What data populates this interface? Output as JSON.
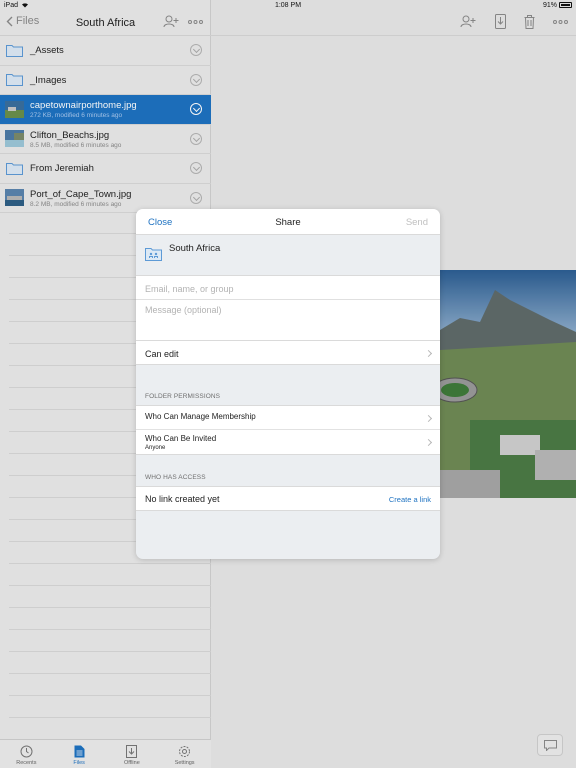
{
  "status_bar": {
    "device": "iPad",
    "time": "1:08 PM",
    "battery": "91%"
  },
  "left_nav": {
    "back_label": "Files",
    "title": "South Africa"
  },
  "files": [
    {
      "name": "_Assets",
      "kind": "folder",
      "meta": "",
      "selected": false
    },
    {
      "name": "_Images",
      "kind": "folder",
      "meta": "",
      "selected": false
    },
    {
      "name": "capetownairporthome.jpg",
      "kind": "image",
      "meta": "272 KB, modified 6 minutes ago",
      "selected": true
    },
    {
      "name": "Clifton_Beachs.jpg",
      "kind": "image",
      "meta": "8.5 MB, modified 6 minutes ago",
      "selected": false
    },
    {
      "name": "From Jeremiah",
      "kind": "folder",
      "meta": "",
      "selected": false
    },
    {
      "name": "Port_of_Cape_Town.jpg",
      "kind": "image",
      "meta": "8.2 MB, modified 6 minutes ago",
      "selected": false
    }
  ],
  "tabs": [
    {
      "label": "Recents",
      "icon": "clock-icon",
      "active": false
    },
    {
      "label": "Files",
      "icon": "file-icon",
      "active": true
    },
    {
      "label": "Offline",
      "icon": "offline-icon",
      "active": false
    },
    {
      "label": "Settings",
      "icon": "gear-icon",
      "active": false
    }
  ],
  "share": {
    "close_label": "Close",
    "title": "Share",
    "send_label": "Send",
    "folder_name": "South Africa",
    "email_placeholder": "Email, name, or group",
    "message_placeholder": "Message (optional)",
    "permission_label": "Can edit",
    "folder_permissions_header": "FOLDER PERMISSIONS",
    "manage_membership_label": "Who Can Manage Membership",
    "invite_label": "Who Can Be Invited",
    "invite_value": "Anyone",
    "access_header": "WHO HAS ACCESS",
    "link_status": "No link created yet",
    "create_link_label": "Create a link"
  },
  "colors": {
    "accent": "#1e72c1",
    "selected_row": "#1e72c1"
  }
}
